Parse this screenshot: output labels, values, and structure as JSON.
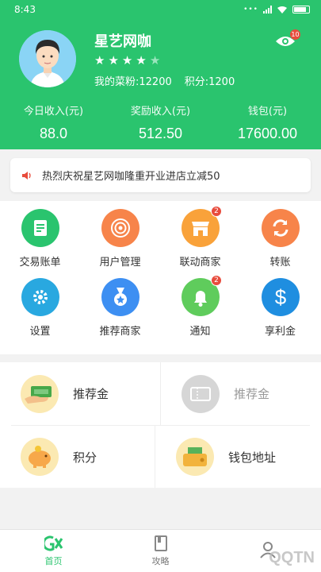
{
  "status_bar": {
    "time": "8:43"
  },
  "profile": {
    "name": "星艺网咖",
    "rating": 4,
    "max_rating": 5,
    "fans": "我的菜粉:12200",
    "points": "积分:1200",
    "eye_badge": "10"
  },
  "income": [
    {
      "label": "今日收入(元)",
      "value": "88.0"
    },
    {
      "label": "奖励收入(元)",
      "value": "512.50"
    },
    {
      "label": "钱包(元)",
      "value": "17600.00"
    }
  ],
  "notice": {
    "text": "热烈庆祝星艺网咖隆重开业进店立减50"
  },
  "grid": [
    {
      "label": "交易账单",
      "icon": "bill-icon",
      "color": "#2ac46e",
      "badge": ""
    },
    {
      "label": "用户管理",
      "icon": "target-icon",
      "color": "#f7844a",
      "badge": ""
    },
    {
      "label": "联动商家",
      "icon": "store-icon",
      "color": "#f9a23a",
      "badge": "2"
    },
    {
      "label": "转账",
      "icon": "refresh-icon",
      "color": "#f7844a",
      "badge": ""
    },
    {
      "label": "设置",
      "icon": "gear-icon",
      "color": "#29a8e0",
      "badge": ""
    },
    {
      "label": "推荐商家",
      "icon": "medal-icon",
      "color": "#3d8ff2",
      "badge": ""
    },
    {
      "label": "通知",
      "icon": "bell-icon",
      "color": "#5fcc5c",
      "badge": "2"
    },
    {
      "label": "享利金",
      "icon": "dollar-icon",
      "color": "#1f8ee0",
      "badge": ""
    }
  ],
  "list": [
    {
      "label": "推荐金",
      "icon": "money-hand-icon",
      "dim": false
    },
    {
      "label": "推荐金",
      "icon": "ticket-icon",
      "dim": true
    },
    {
      "label": "积分",
      "icon": "piggy-bank-icon",
      "dim": false
    },
    {
      "label": "钱包地址",
      "icon": "wallet-icon",
      "dim": false
    }
  ],
  "tabs": [
    {
      "label": "首页",
      "icon": "home-logo-icon",
      "active": true
    },
    {
      "label": "攻略",
      "icon": "book-icon",
      "active": false
    },
    {
      "label": "",
      "icon": "profile-icon",
      "active": false
    }
  ],
  "watermark": "QQTN",
  "colors": {
    "brand": "#2ac46e",
    "badge": "#e84c3d"
  }
}
